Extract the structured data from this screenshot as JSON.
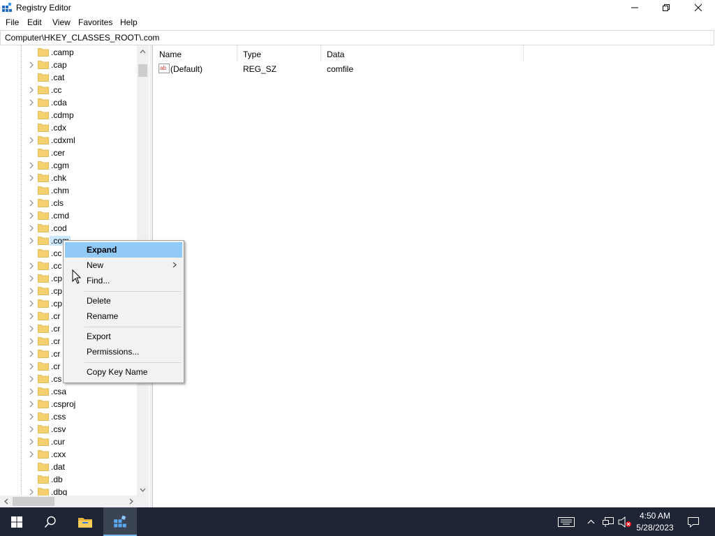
{
  "window": {
    "title": "Registry Editor",
    "icon": "regedit-icon",
    "controls": [
      "minimize-icon",
      "restore-icon",
      "close-icon"
    ]
  },
  "menu": [
    "File",
    "Edit",
    "View",
    "Favorites",
    "Help"
  ],
  "address": "Computer\\HKEY_CLASSES_ROOT\\.com",
  "tree": {
    "items": [
      {
        "label": ".camp",
        "expandable": false
      },
      {
        "label": ".cap",
        "expandable": true
      },
      {
        "label": ".cat",
        "expandable": false
      },
      {
        "label": ".cc",
        "expandable": true
      },
      {
        "label": ".cda",
        "expandable": true
      },
      {
        "label": ".cdmp",
        "expandable": false
      },
      {
        "label": ".cdx",
        "expandable": false
      },
      {
        "label": ".cdxml",
        "expandable": true
      },
      {
        "label": ".cer",
        "expandable": false
      },
      {
        "label": ".cgm",
        "expandable": true
      },
      {
        "label": ".chk",
        "expandable": true
      },
      {
        "label": ".chm",
        "expandable": false
      },
      {
        "label": ".cls",
        "expandable": true
      },
      {
        "label": ".cmd",
        "expandable": true
      },
      {
        "label": ".cod",
        "expandable": true
      },
      {
        "label": ".com",
        "expandable": true,
        "selected": true
      },
      {
        "label": ".cc",
        "expandable": false
      },
      {
        "label": ".cc",
        "expandable": true
      },
      {
        "label": ".cp",
        "expandable": true
      },
      {
        "label": ".cp",
        "expandable": true
      },
      {
        "label": ".cp",
        "expandable": true
      },
      {
        "label": ".cr",
        "expandable": true
      },
      {
        "label": ".cr",
        "expandable": true
      },
      {
        "label": ".cr",
        "expandable": true
      },
      {
        "label": ".cr",
        "expandable": true
      },
      {
        "label": ".cr",
        "expandable": true
      },
      {
        "label": ".cs",
        "expandable": true
      },
      {
        "label": ".csa",
        "expandable": true
      },
      {
        "label": ".csproj",
        "expandable": true
      },
      {
        "label": ".css",
        "expandable": true
      },
      {
        "label": ".csv",
        "expandable": true
      },
      {
        "label": ".cur",
        "expandable": true
      },
      {
        "label": ".cxx",
        "expandable": true
      },
      {
        "label": ".dat",
        "expandable": false
      },
      {
        "label": ".db",
        "expandable": false
      },
      {
        "label": ".dbg",
        "expandable": true
      }
    ]
  },
  "list": {
    "columns": [
      "Name",
      "Type",
      "Data"
    ],
    "rows": [
      {
        "name": "(Default)",
        "type": "REG_SZ",
        "data": "comfile",
        "icon": "string-value-icon"
      }
    ]
  },
  "context_menu": {
    "items": [
      {
        "label": "Expand",
        "highlighted": true,
        "bold": true
      },
      {
        "label": "New",
        "submenu": true
      },
      {
        "label": "Find..."
      },
      {
        "separator": true
      },
      {
        "label": "Delete"
      },
      {
        "label": "Rename"
      },
      {
        "separator": true
      },
      {
        "label": "Export"
      },
      {
        "label": "Permissions..."
      },
      {
        "separator": true
      },
      {
        "label": "Copy Key Name"
      }
    ]
  },
  "taskbar": {
    "time": "4:50 AM",
    "date": "5/28/2023",
    "pinned": [
      "windows-start-icon",
      "search-icon",
      "file-explorer-icon",
      "regedit-icon"
    ],
    "tray": [
      "action-center-keyboard-icon",
      "chevron-up-icon",
      "network-icon",
      "volume-muted-icon",
      "notifications-icon"
    ]
  },
  "colors": {
    "taskbar": "#1d2433",
    "menu_highlight": "#91c9f7",
    "folder": "#f4d06f",
    "accent": "#76b9ed"
  }
}
